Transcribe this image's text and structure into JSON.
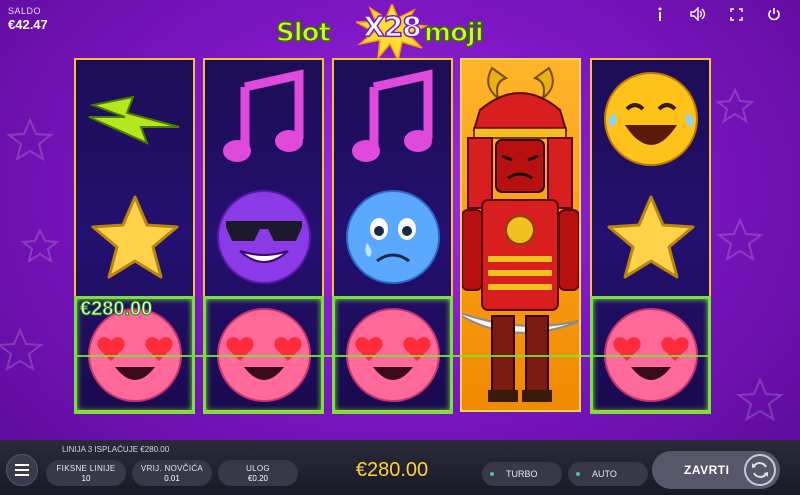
{
  "balance": {
    "label": "SALDO",
    "value": "€42.47"
  },
  "top_icons": [
    "info-icon",
    "sound-icon",
    "fullscreen-icon",
    "power-icon"
  ],
  "logo": {
    "part1": "Slot",
    "multiplier": "X28",
    "part2": "moji"
  },
  "reels": [
    [
      "lightning",
      "star",
      "heart-eyes"
    ],
    [
      "music-note",
      "sunglasses",
      "heart-eyes"
    ],
    [
      "music-note",
      "sad-tear",
      "heart-eyes"
    ],
    [
      "samurai"
    ],
    [
      "laughing",
      "star",
      "heart-eyes"
    ]
  ],
  "win_label": "€280.00",
  "line_info": "LINIJA 3 ISPLAĆUJE €280.00",
  "controls": {
    "fixed_lines": {
      "label": "FIKSNE LINIJE",
      "value": "10"
    },
    "coin_value": {
      "label": "VRIJ. NOVČIĆA",
      "value": "0.01"
    },
    "bet": {
      "label": "ULOG",
      "value": "€0.20"
    },
    "total_win": "€280.00",
    "turbo": "TURBO",
    "auto": "AUTO",
    "spin": "ZAVRTI"
  },
  "colors": {
    "reel_border": "#f2c23a",
    "win_frame": "#7ae03a",
    "win_text": "#ffd23a",
    "background": "#7c16c2"
  }
}
